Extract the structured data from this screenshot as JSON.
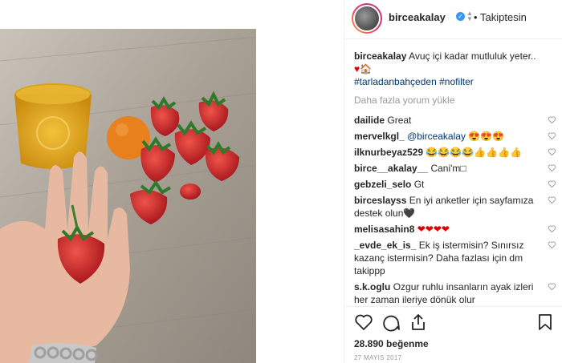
{
  "post": {
    "username": "birceakalay",
    "follow_dot": "•",
    "follow_label": "Takiptesin",
    "caption_user": "birceakalay",
    "caption_text": "Avuç içi kadar mutluluk yeter..",
    "caption_emoji": "♥🏠",
    "caption_tags": "#tarladanbahçeden #nofilter",
    "load_more": "Daha fazla yorum yükle",
    "likes": "28.890 beğenme",
    "date": "27 MAYIS 2017"
  },
  "comments": [
    {
      "user": "dailide",
      "text": "Great"
    },
    {
      "user": "mervelkgl_",
      "text": "@birceakalay 😍😍😍"
    },
    {
      "user": "ilknurbeyaz529",
      "text": "😂😂😂😂👍👍👍👍"
    },
    {
      "user": "birce__akalay__",
      "text": "Cani'm□"
    },
    {
      "user": "gebzeli_selo",
      "text": "Gt"
    },
    {
      "user": "birceslayss",
      "text": "En iyi anketler için sayfamıza destek olun🖤"
    },
    {
      "user": "melisasahin8",
      "text": "❤❤❤❤"
    },
    {
      "user": "_evde_ek_is_",
      "text": "Ek iş istermisin? Sınırsız kazanç istermisin? Daha fazlası için dm takippp"
    },
    {
      "user": "s.k.oglu",
      "text": "Ozgur ruhlu insanların ayak izleri her zaman ileriye dönük olur"
    }
  ],
  "icons": {
    "verified": "verified-badge-icon",
    "like": "heart-icon",
    "comment": "comment-icon",
    "share": "share-icon",
    "save": "bookmark-icon"
  },
  "colors": {
    "accent": "#3897f0",
    "tag": "#003569",
    "muted": "#999999"
  }
}
